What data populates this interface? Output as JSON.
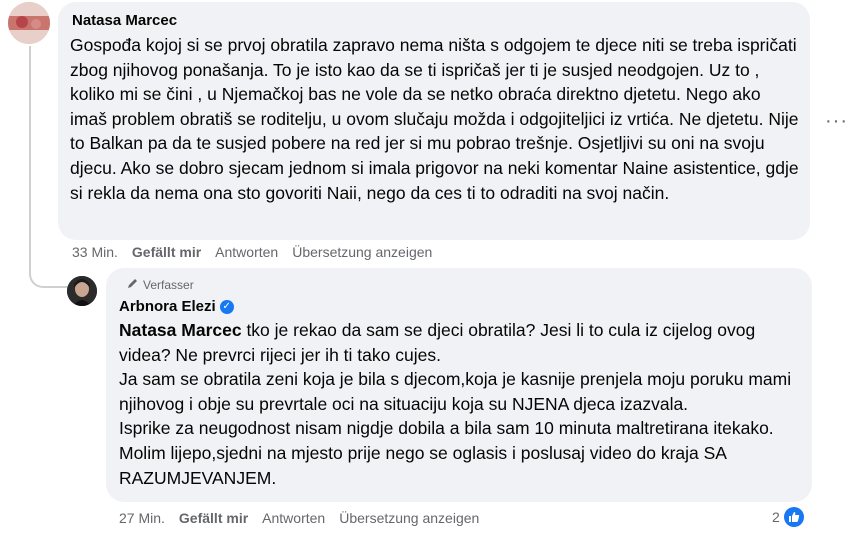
{
  "comment1": {
    "author": "Natasa Marcec",
    "text": "Gospođa kojoj si se prvoj obratila zapravo nema ništa s odgojem te djece niti se treba ispričati zbog njihovog ponašanja. To je isto kao da se ti ispričaš jer ti je susjed neodgojen. Uz to , koliko mi se čini , u Njemačkoj bas ne vole da se netko obraća direktno djetetu. Nego ako imaš problem obratiš se roditelju, u ovom slučaju možda i odgojiteljici iz vrtića. Ne djetetu. Nije to Balkan pa da te susjed pobere na red jer si mu pobrao trešnje. Osjetljivi su oni na svoju djecu. Ako se dobro sjecam jednom si imala prigovor na neki komentar Naine asistentice, gdje si rekla da nema ona sto govoriti Naii, nego da ces ti to odraditi na svoj način.",
    "time": "33 Min.",
    "like": "Gefällt mir",
    "reply": "Antworten",
    "translate": "Übersetzung anzeigen"
  },
  "comment2": {
    "badge": "Verfasser",
    "author": "Arbnora Elezi",
    "mention": "Natasa Marcec",
    "text": " tko je rekao da sam se djeci obratila? Jesi li to cula iz cijelog ovog videa? Ne prevrci rijeci jer ih ti tako cujes.\nJa sam se obratila zeni koja je bila s djecom,koja je kasnije prenjela moju poruku mami njihovog i obje su prevrtale oci na situaciju koja su NJENA djeca izazvala.\nIsprike za neugodnost nisam nigdje dobila a bila sam 10 minuta maltretirana itekako. Molim lijepo,sjedni na mjesto prije nego se oglasis i poslusaj video do kraja SA RAZUMJEVANJEM.",
    "time": "27 Min.",
    "like": "Gefällt mir",
    "reply": "Antworten",
    "translate": "Übersetzung anzeigen",
    "reaction_count": "2"
  },
  "icons": {
    "more": "more-options-icon",
    "pencil": "pencil-icon",
    "verified": "verified-badge-icon",
    "like": "like-reaction-icon"
  },
  "colors": {
    "bubble": "#f0f2f5",
    "secondary_text": "#65676b",
    "accent": "#1877f2"
  }
}
